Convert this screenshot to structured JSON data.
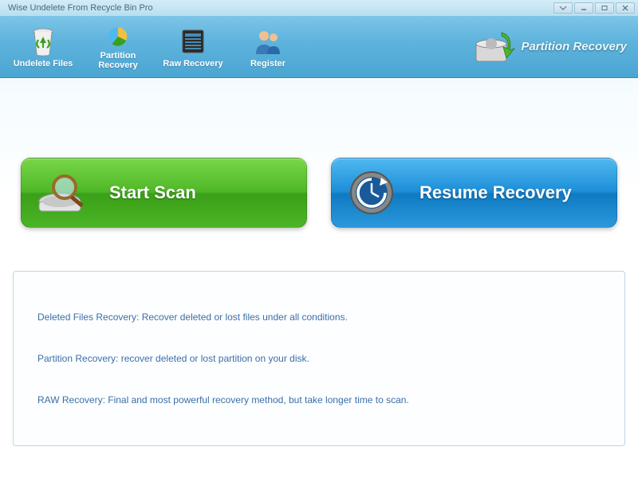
{
  "window": {
    "title": "Wise Undelete From Recycle Bin Pro"
  },
  "toolbar": {
    "undelete_label": "Undelete Files",
    "partition_label": "Partition\nRecovery",
    "raw_label": "Raw Recovery",
    "register_label": "Register"
  },
  "header_right": {
    "label": "Partition Recovery"
  },
  "main": {
    "start_scan_label": "Start  Scan",
    "resume_recovery_label": "Resume Recovery"
  },
  "info": {
    "line1": "Deleted Files Recovery: Recover deleted or lost files  under all conditions.",
    "line2": "Partition Recovery: recover deleted or lost partition on your disk.",
    "line3": "RAW Recovery: Final and most powerful recovery method, but take longer time to scan."
  }
}
